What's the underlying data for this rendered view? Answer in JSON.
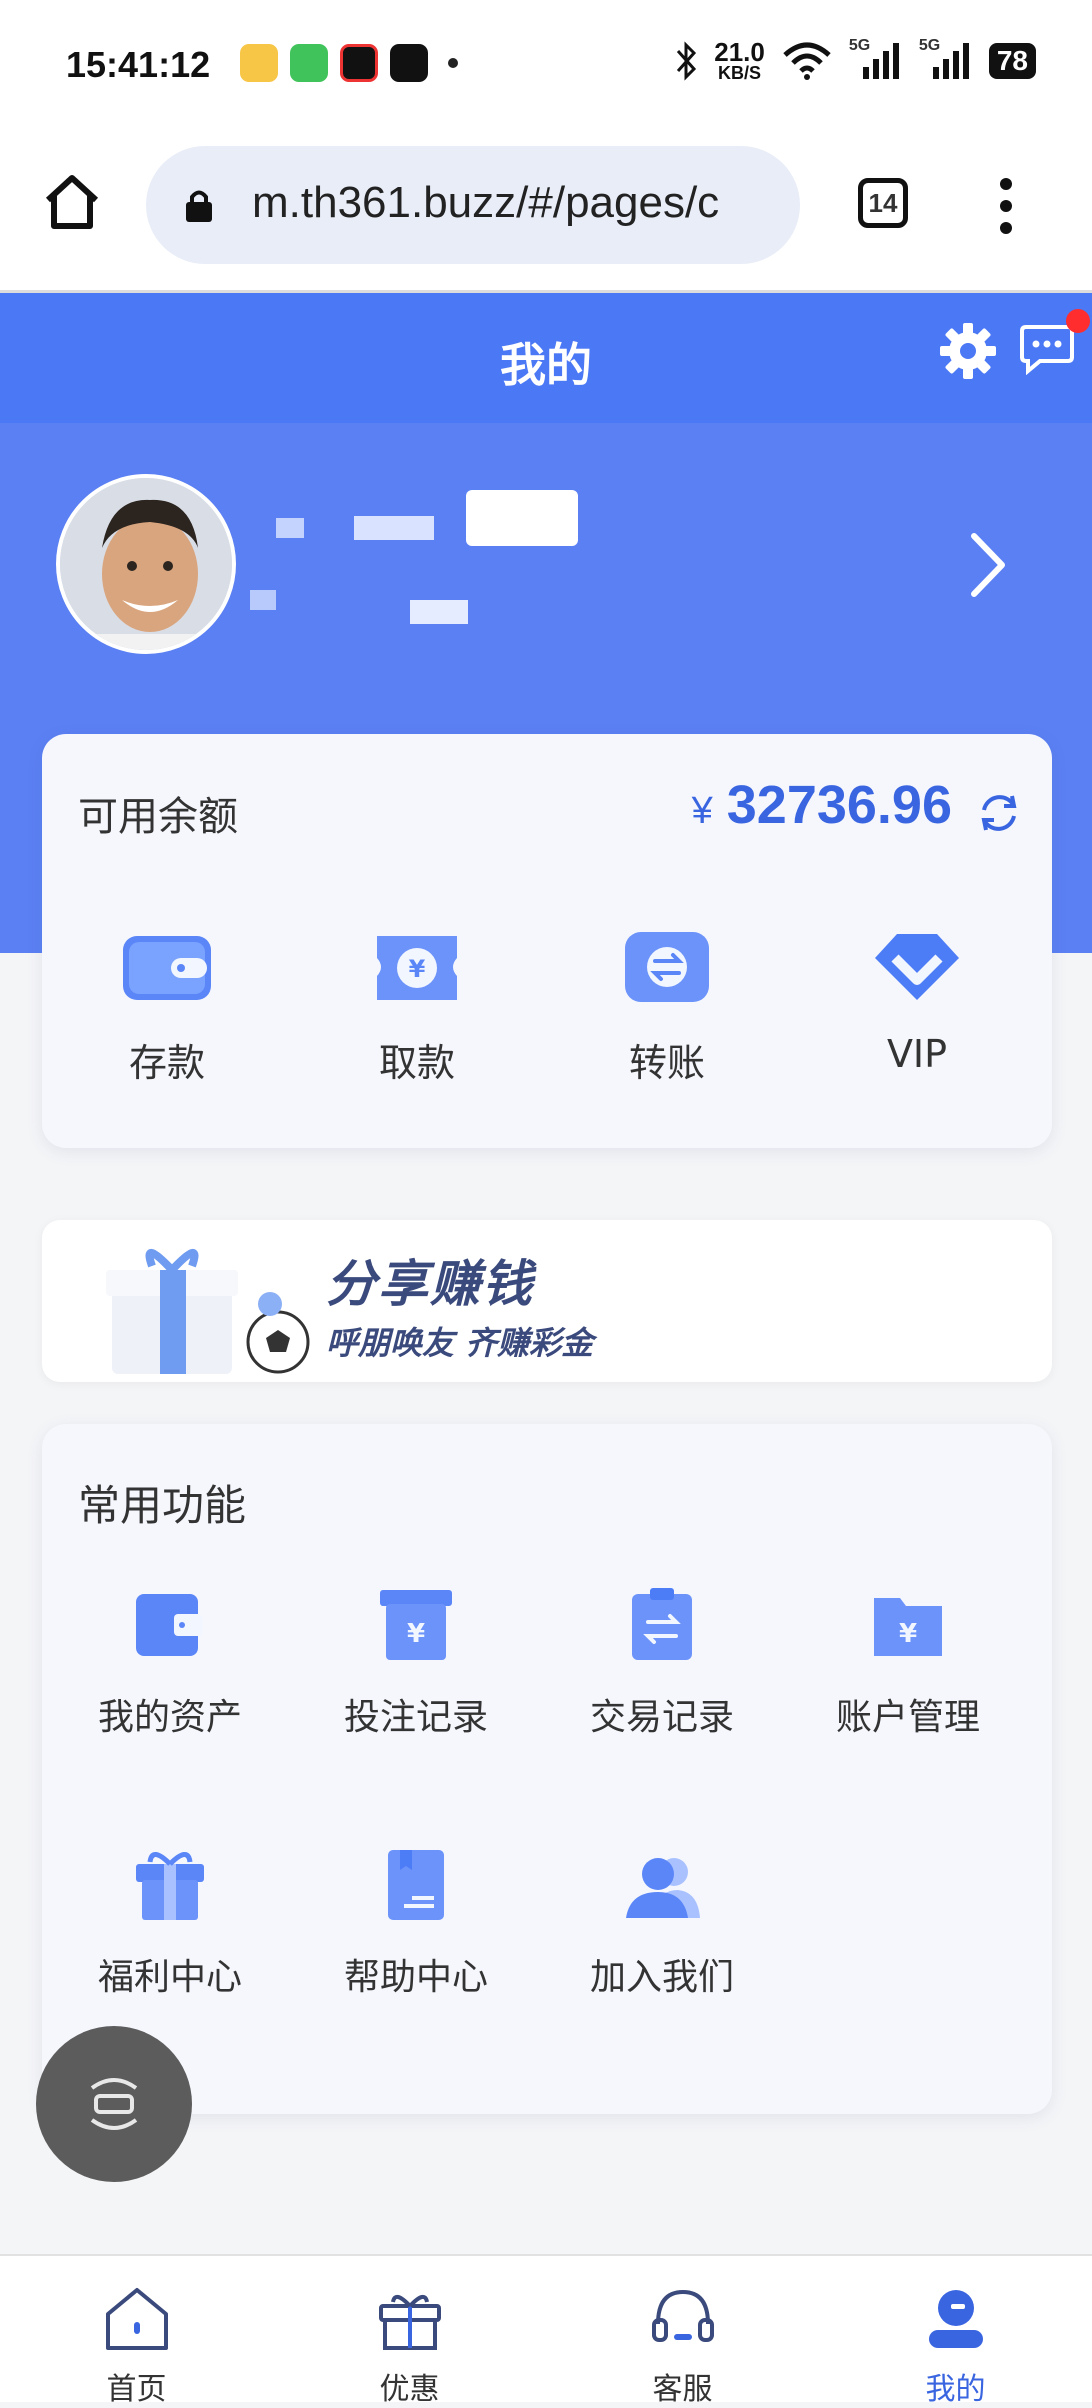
{
  "status_bar": {
    "time": "15:41:12",
    "net_speed_value": "21.0",
    "net_speed_unit": "KB/S",
    "signal1": "5G",
    "signal2": "5G",
    "battery": "78"
  },
  "browser": {
    "url": "m.th361.buzz/#/pages/c",
    "tab_count": "14"
  },
  "header": {
    "title": "我的"
  },
  "balance": {
    "label": "可用余额",
    "currency": "¥",
    "amount": "32736.96",
    "actions": [
      {
        "label": "存款",
        "icon": "wallet-icon"
      },
      {
        "label": "取款",
        "icon": "yuan-ticket-icon"
      },
      {
        "label": "转账",
        "icon": "transfer-icon"
      },
      {
        "label": "VIP",
        "icon": "vip-icon"
      }
    ]
  },
  "banner": {
    "title": "分享赚钱",
    "subtitle": "呼朋唤友 齐赚彩金"
  },
  "functions": {
    "title": "常用功能",
    "items": [
      {
        "label": "我的资产",
        "icon": "wallet-icon"
      },
      {
        "label": "投注记录",
        "icon": "bet-box-icon"
      },
      {
        "label": "交易记录",
        "icon": "transaction-clipboard-icon"
      },
      {
        "label": "账户管理",
        "icon": "account-folder-icon"
      },
      {
        "label": "福利中心",
        "icon": "gift-icon"
      },
      {
        "label": "帮助中心",
        "icon": "help-book-icon"
      },
      {
        "label": "加入我们",
        "icon": "users-icon"
      }
    ]
  },
  "bottom_nav": [
    {
      "label": "首页",
      "icon": "home-icon"
    },
    {
      "label": "优惠",
      "icon": "gift-icon"
    },
    {
      "label": "客服",
      "icon": "headset-icon"
    },
    {
      "label": "我的",
      "icon": "profile-icon",
      "active": true
    }
  ],
  "colors": {
    "brand_blue": "#4b78f5",
    "amount_blue": "#3a65e0",
    "badge_red": "#ff2d2d"
  }
}
